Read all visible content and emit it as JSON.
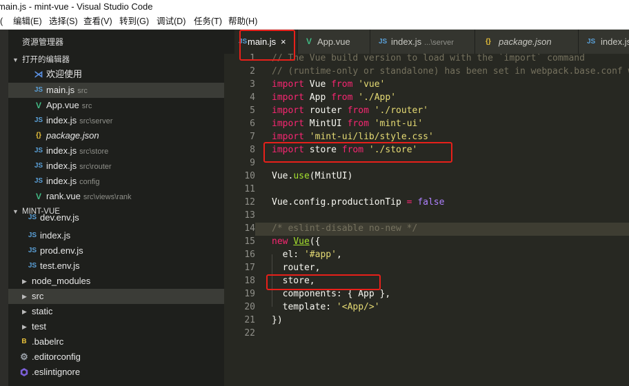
{
  "window": {
    "title": "main.js - mint-vue - Visual Studio Code"
  },
  "menu": [
    "编辑(E)",
    "选择(S)",
    "查看(V)",
    "转到(G)",
    "调试(D)",
    "任务(T)",
    "帮助(H)"
  ],
  "menu_partial": "(",
  "sidebar": {
    "title": "资源管理器",
    "open_editors_label": "打开的编辑器",
    "open_editors": [
      {
        "name": "欢迎使用",
        "desc": "",
        "icon": "vscode-icon"
      },
      {
        "name": "main.js",
        "desc": "src",
        "icon": "js-icon"
      },
      {
        "name": "App.vue",
        "desc": "src",
        "icon": "vue-icon"
      },
      {
        "name": "index.js",
        "desc": "src\\server",
        "icon": "js-icon"
      },
      {
        "name": "package.json",
        "desc": "",
        "icon": "json-icon"
      },
      {
        "name": "index.js",
        "desc": "src\\store",
        "icon": "js-icon"
      },
      {
        "name": "index.js",
        "desc": "src\\router",
        "icon": "js-icon"
      },
      {
        "name": "index.js",
        "desc": "config",
        "icon": "js-icon"
      },
      {
        "name": "rank.vue",
        "desc": "src\\views\\rank",
        "icon": "vue-icon"
      }
    ],
    "project_label": "MINT-VUE",
    "tree": [
      {
        "name": "dev.env.js",
        "icon": "js-icon"
      },
      {
        "name": "index.js",
        "icon": "js-icon"
      },
      {
        "name": "prod.env.js",
        "icon": "js-icon"
      },
      {
        "name": "test.env.js",
        "icon": "js-icon"
      },
      {
        "name": "node_modules",
        "icon": "folder-collapsed"
      },
      {
        "name": "src",
        "icon": "folder-collapsed"
      },
      {
        "name": "static",
        "icon": "folder-collapsed"
      },
      {
        "name": "test",
        "icon": "folder-collapsed"
      },
      {
        "name": ".babelrc",
        "icon": "babel-icon"
      },
      {
        "name": ".editorconfig",
        "icon": "gear-icon"
      },
      {
        "name": ".eslintignore",
        "icon": "eslint-icon"
      }
    ]
  },
  "tabs": [
    {
      "name": "main.js",
      "desc": "",
      "icon": "js-icon",
      "active": true,
      "close": "×"
    },
    {
      "name": "App.vue",
      "desc": "",
      "icon": "vue-icon",
      "active": false
    },
    {
      "name": "index.js",
      "desc": "...\\server",
      "icon": "js-icon",
      "active": false
    },
    {
      "name": "package.json",
      "desc": "",
      "icon": "json-icon",
      "active": false
    },
    {
      "name": "index.js",
      "desc": "",
      "icon": "js-icon",
      "active": false
    }
  ],
  "icon_glyphs": {
    "js": "JS",
    "vue": "V",
    "json": "{}",
    "vscode": "⋊",
    "gear": "⚙",
    "babel": "B"
  },
  "code": {
    "line_numbers": [
      "1",
      "2",
      "3",
      "4",
      "5",
      "6",
      "7",
      "8",
      "9",
      "10",
      "11",
      "12",
      "13",
      "14",
      "15",
      "16",
      "17",
      "18",
      "19",
      "20",
      "21",
      "22"
    ],
    "lines": [
      "// The Vue build version to load with the `import` command",
      "// (runtime-only or standalone) has been set in webpack.base.conf wi",
      "import Vue from 'vue'",
      "import App from './App'",
      "import router from './router'",
      "import MintUI from 'mint-ui'",
      "import 'mint-ui/lib/style.css'",
      "import store from './store'",
      "",
      "Vue.use(MintUI)",
      "",
      "Vue.config.productionTip = false",
      "",
      "/* eslint-disable no-new */",
      "new Vue({",
      "  el: '#app',",
      "  router,",
      "  store,",
      "  components: { App },",
      "  template: '<App/>'",
      "})",
      ""
    ]
  },
  "colors": {
    "annotation_box": "#e8201a",
    "editor_bg": "#272822",
    "keyword": "#f92672",
    "string": "#e6db74",
    "comment": "#75715e"
  }
}
